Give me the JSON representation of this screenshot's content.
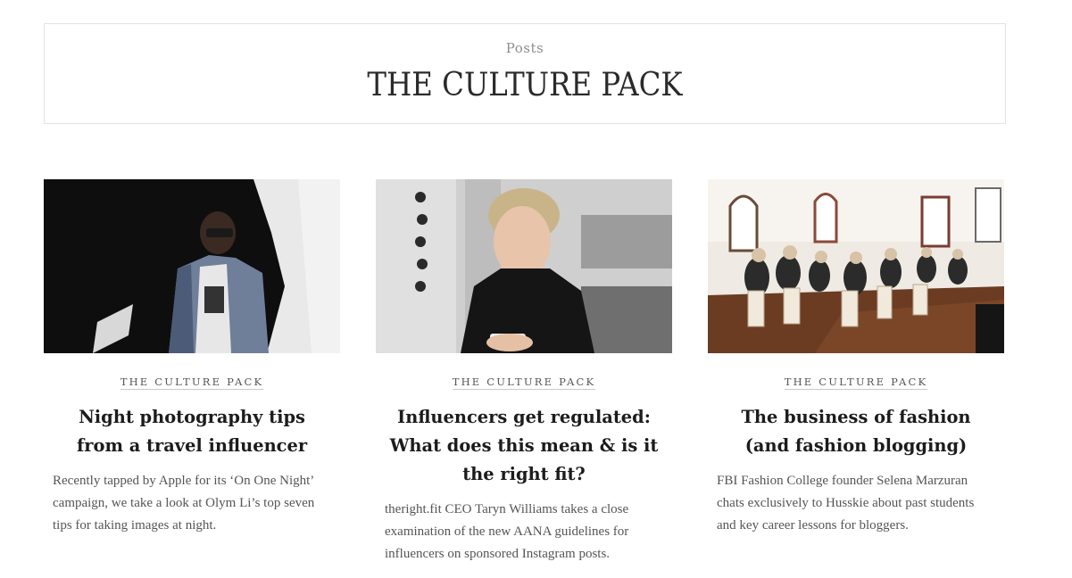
{
  "header": {
    "kicker": "Posts",
    "title": "THE CULTURE PACK"
  },
  "posts": [
    {
      "category": "THE CULTURE PACK",
      "title": "Night photography tips from a travel influencer",
      "excerpt": "Recently tapped by Apple for its ‘On One Night’ campaign, we take a look at Olym Li’s top seven tips for taking images at night.",
      "image": "man-portrait-photo"
    },
    {
      "category": "THE CULTURE PACK",
      "title": "Influencers get regulated: What does this mean & is it the right fit?",
      "excerpt": "theright.fit CEO Taryn Williams takes a close examination of the new AANA guidelines for influencers on sponsored Instagram posts.",
      "image": "woman-phone-photo"
    },
    {
      "category": "THE CULTURE PACK",
      "title": "The business of fashion (and fashion blogging)",
      "excerpt": "FBI Fashion College founder Selena Marzuran chats exclusively to Husskie about past students and key career lessons for bloggers.",
      "image": "event-audience-photo"
    }
  ]
}
